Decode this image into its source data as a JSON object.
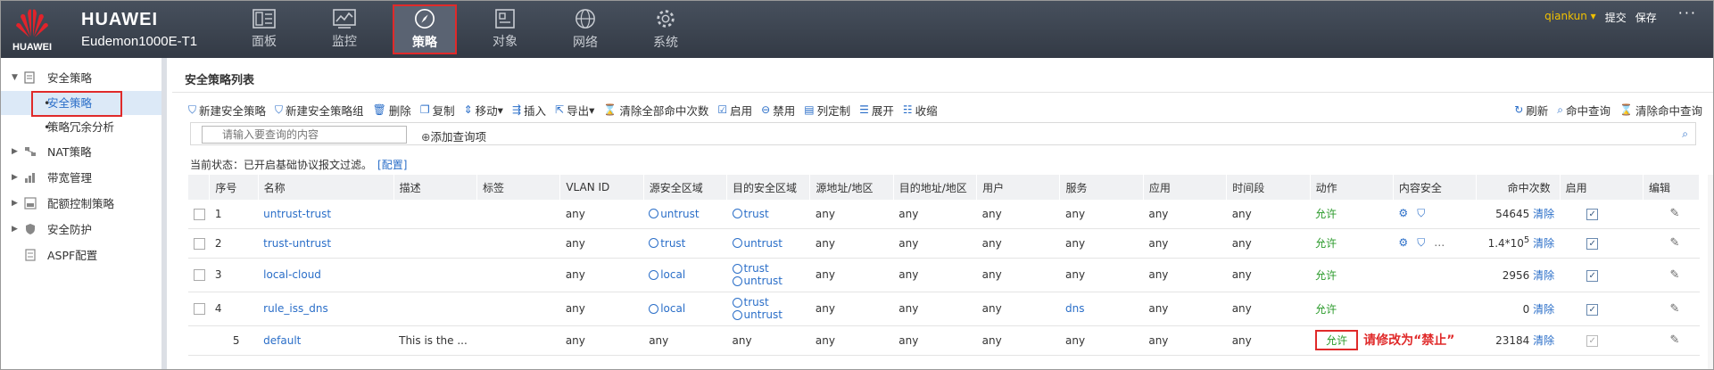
{
  "brand": {
    "logo_text": "HUAWEI",
    "title": "HUAWEI",
    "model": "Eudemon1000E-T1"
  },
  "nav": [
    {
      "label": "面板",
      "icon": "dashboard-icon"
    },
    {
      "label": "监控",
      "icon": "monitor-icon"
    },
    {
      "label": "策略",
      "icon": "compass-icon",
      "active": true
    },
    {
      "label": "对象",
      "icon": "object-icon"
    },
    {
      "label": "网络",
      "icon": "globe-icon"
    },
    {
      "label": "系统",
      "icon": "gear-icon"
    }
  ],
  "top_right": {
    "user": "qiankun",
    "submit": "提交",
    "save": "保存",
    "more": "···"
  },
  "sidebar": {
    "groups": [
      {
        "label": "安全策略",
        "expanded": true
      },
      {
        "label": "NAT策略"
      },
      {
        "label": "带宽管理"
      },
      {
        "label": "配额控制策略"
      },
      {
        "label": "安全防护"
      },
      {
        "label": "ASPF配置"
      }
    ],
    "sub_items": [
      "安全策略",
      "策略冗余分析"
    ]
  },
  "main": {
    "title": "安全策略列表",
    "toolbar": {
      "new_policy": "新建安全策略",
      "new_group": "新建安全策略组",
      "delete": "删除",
      "copy": "复制",
      "move": "移动",
      "insert": "插入",
      "export": "导出",
      "clear_all_hits": "清除全部命中次数",
      "enable": "启用",
      "disable": "禁用",
      "custom_cols": "列定制",
      "expand": "展开",
      "collapse": "收缩",
      "refresh": "刷新",
      "hit_query": "命中查询",
      "clear_hits": "清除命中查询"
    },
    "search": {
      "placeholder": "请输入要查询的内容",
      "add_query": "添加查询项"
    },
    "status": {
      "text": "当前状态：已开启基础协议报文过滤。",
      "config": "[配置]"
    }
  },
  "table": {
    "headers": [
      "序号",
      "名称",
      "描述",
      "标签",
      "VLAN ID",
      "源安全区域",
      "目的安全区域",
      "源地址/地区",
      "目的地址/地区",
      "用户",
      "服务",
      "应用",
      "时间段",
      "动作",
      "内容安全",
      "命中次数",
      "启用",
      "编辑"
    ],
    "rows": [
      {
        "no": "1",
        "name": "untrust-trust",
        "desc": "",
        "tag": "",
        "vlan": "any",
        "src_zone": [
          "untrust"
        ],
        "dst_zone": [
          "trust"
        ],
        "src_addr": "any",
        "dst_addr": "any",
        "user": "any",
        "service": "any",
        "app": "any",
        "time": "any",
        "action": "允许",
        "content_sec": "shield",
        "hits": "54645",
        "clear": "清除"
      },
      {
        "no": "2",
        "name": "trust-untrust",
        "desc": "",
        "tag": "",
        "vlan": "any",
        "src_zone": [
          "trust"
        ],
        "dst_zone": [
          "untrust"
        ],
        "src_addr": "any",
        "dst_addr": "any",
        "user": "any",
        "service": "any",
        "app": "any",
        "time": "any",
        "action": "允许",
        "content_sec": "shield-more",
        "hits": "1.4*10",
        "hits_sup": "5",
        "clear": "清除"
      },
      {
        "no": "3",
        "name": "local-cloud",
        "desc": "",
        "tag": "",
        "vlan": "any",
        "src_zone": [
          "local"
        ],
        "dst_zone": [
          "trust",
          "untrust"
        ],
        "src_addr": "any",
        "dst_addr": "any",
        "user": "any",
        "service": "any",
        "app": "any",
        "time": "any",
        "action": "允许",
        "content_sec": "",
        "hits": "2956",
        "clear": "清除"
      },
      {
        "no": "4",
        "name": "rule_iss_dns",
        "desc": "",
        "tag": "",
        "vlan": "any",
        "src_zone": [
          "local"
        ],
        "dst_zone": [
          "trust",
          "untrust"
        ],
        "src_addr": "any",
        "dst_addr": "any",
        "user": "any",
        "service": "dns",
        "app": "any",
        "time": "any",
        "action": "允许",
        "content_sec": "",
        "hits": "0",
        "clear": "清除"
      },
      {
        "no": "5",
        "name": "default",
        "desc": "This is the ...",
        "tag": "",
        "vlan": "any",
        "src_zone_text": "any",
        "dst_zone_text": "any",
        "src_addr": "any",
        "dst_addr": "any",
        "user": "any",
        "service": "any",
        "app": "any",
        "time": "any",
        "action": "允许",
        "note": "请修改为“禁止”",
        "content_sec": "",
        "hits": "23184",
        "clear": "清除"
      }
    ]
  },
  "colors": {
    "accent": "#2a6ec8",
    "allow": "#2a9a2a",
    "highlight": "#e02a2a",
    "topbar": "#3b4350"
  }
}
